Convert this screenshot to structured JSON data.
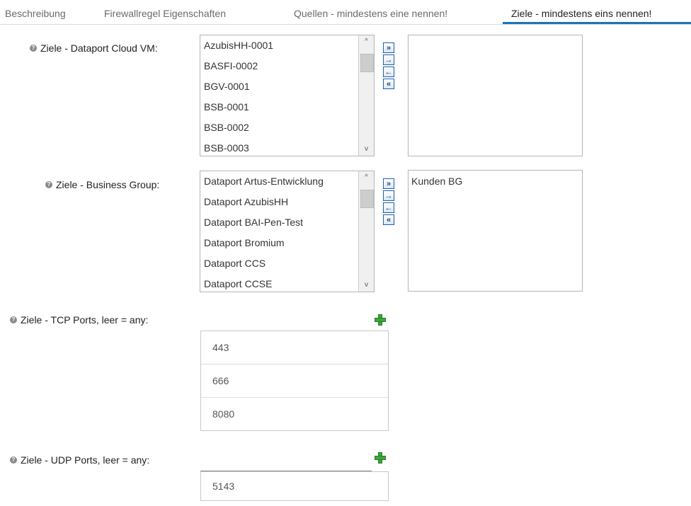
{
  "tabs": [
    {
      "label": "Beschreibung"
    },
    {
      "label": "Firewallregel Eigenschaften"
    },
    {
      "label": "Quellen - mindestens eine nennen!"
    },
    {
      "label": "Ziele - mindestens eins nennen!"
    }
  ],
  "cloud_vm": {
    "label": "Ziele - Dataport Cloud VM:",
    "available": [
      "AzubisHH-0001",
      "BASFI-0002",
      "BGV-0001",
      "BSB-0001",
      "BSB-0002",
      "BSB-0003"
    ],
    "selected": []
  },
  "business_group": {
    "label": "Ziele - Business Group:",
    "available": [
      "Dataport Artus-Entwicklung",
      "Dataport AzubisHH",
      "Dataport BAI-Pen-Test",
      "Dataport Bromium",
      "Dataport CCS",
      "Dataport CCSE"
    ],
    "selected": [
      "Kunden BG"
    ]
  },
  "move_buttons": {
    "all_right": "»",
    "right": "→",
    "left": "←",
    "all_left": "«"
  },
  "scroll": {
    "up": "^",
    "down": "v"
  },
  "tcp": {
    "label": "Ziele - TCP Ports, leer = any:",
    "input_value": "",
    "ports": [
      "443",
      "666",
      "8080"
    ]
  },
  "udp": {
    "label": "Ziele - UDP Ports, leer = any:",
    "input_value": "",
    "ports": [
      "5143"
    ]
  },
  "help_icon": "?",
  "colors": {
    "tab_accent": "#1b75bb",
    "add_green": "#3aa83a",
    "button_blue": "#1d5fa8"
  }
}
